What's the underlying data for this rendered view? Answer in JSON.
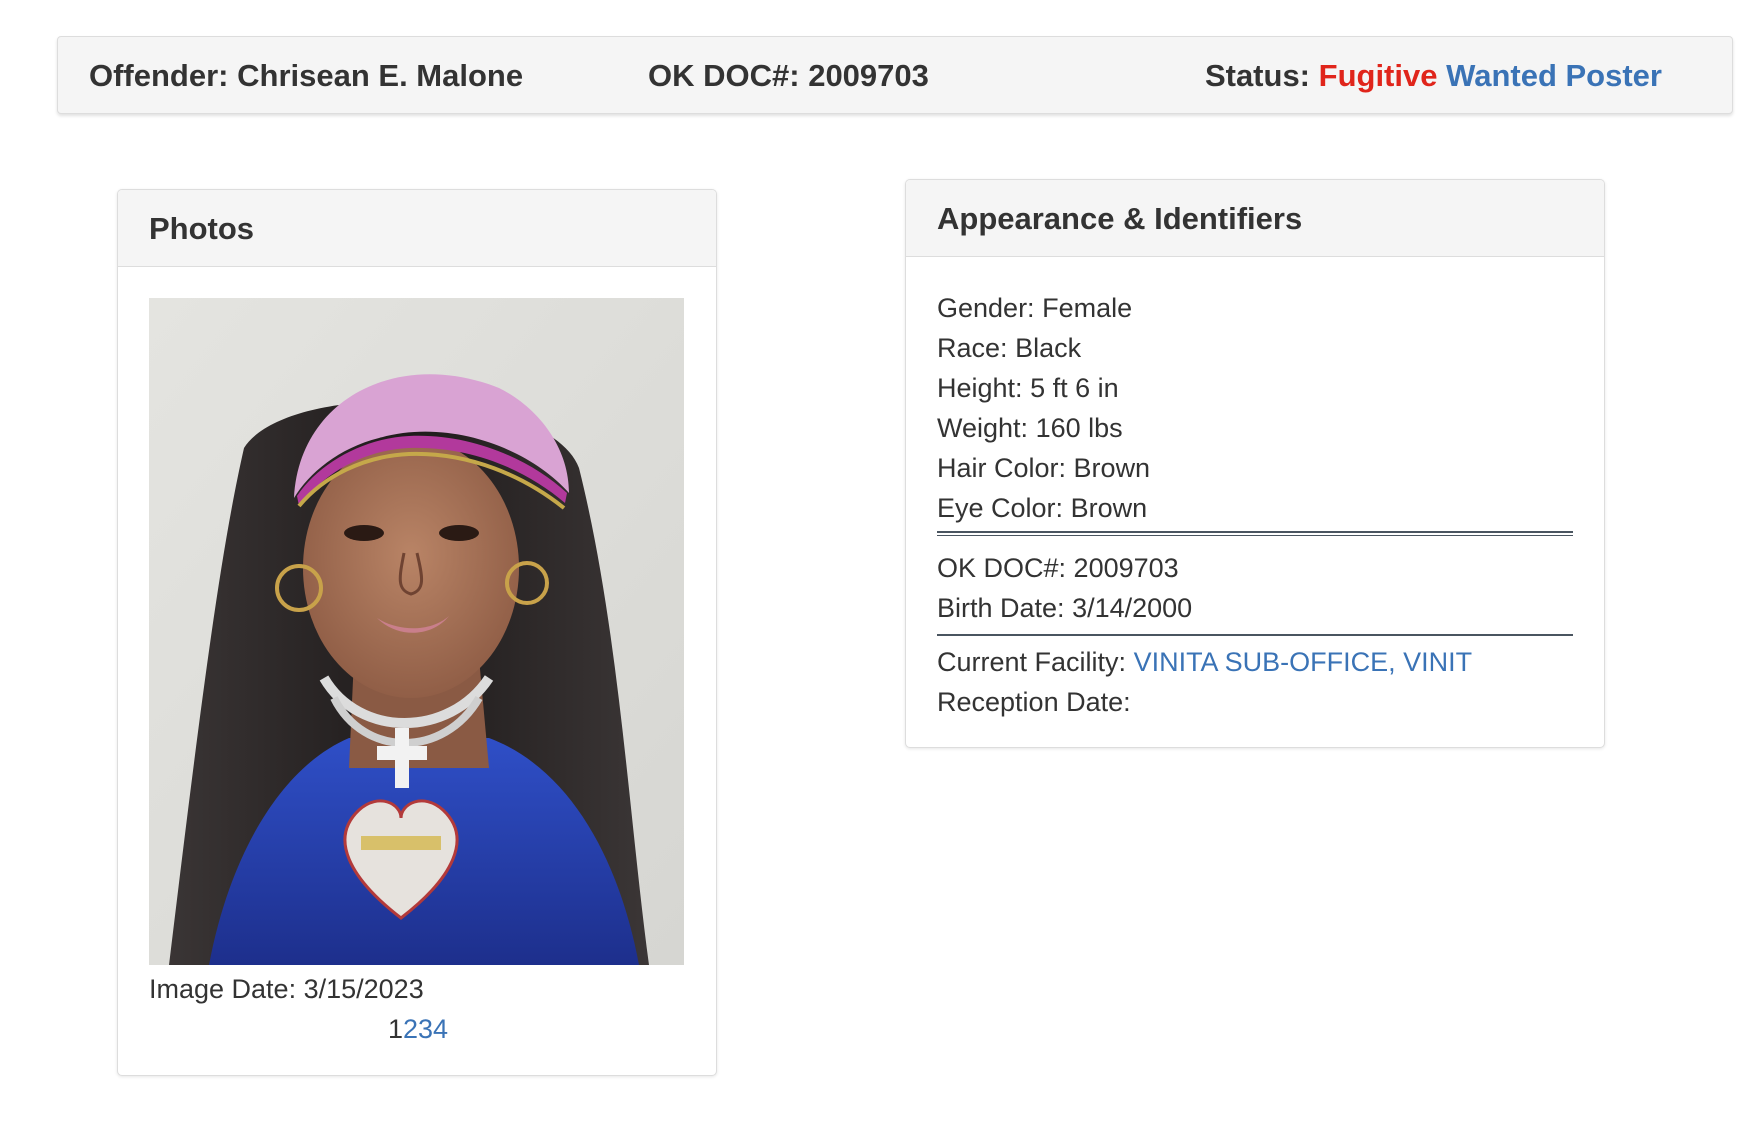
{
  "header": {
    "offender_label": "Offender:",
    "offender_name": "Chrisean E. Malone",
    "doc_label": "OK DOC#:",
    "doc_number": "2009703",
    "status_label": "Status:",
    "status_value": "Fugitive",
    "status_color": "#e0251b",
    "wanted_poster_link": "Wanted Poster",
    "link_color": "#3a73b6"
  },
  "photos": {
    "title": "Photos",
    "image_date_label": "Image Date:",
    "image_date": "3/15/2023",
    "pages": [
      "1",
      "2",
      "3",
      "4"
    ],
    "current_page": "1"
  },
  "appearance": {
    "title": "Appearance & Identifiers",
    "gender_label": "Gender:",
    "gender": "Female",
    "race_label": "Race:",
    "race": "Black",
    "height_label": "Height:",
    "height": "5 ft 6 in",
    "weight_label": "Weight:",
    "weight": "160 lbs",
    "hair_label": "Hair Color:",
    "hair": "Brown",
    "eye_label": "Eye Color:",
    "eye": "Brown",
    "doc_label": "OK DOC#:",
    "doc_number": "2009703",
    "birth_label": "Birth Date:",
    "birth_date": "3/14/2000",
    "facility_label": "Current Facility:",
    "facility": "VINITA SUB-OFFICE, VINIT",
    "reception_label": "Reception Date:",
    "reception_date": ""
  }
}
